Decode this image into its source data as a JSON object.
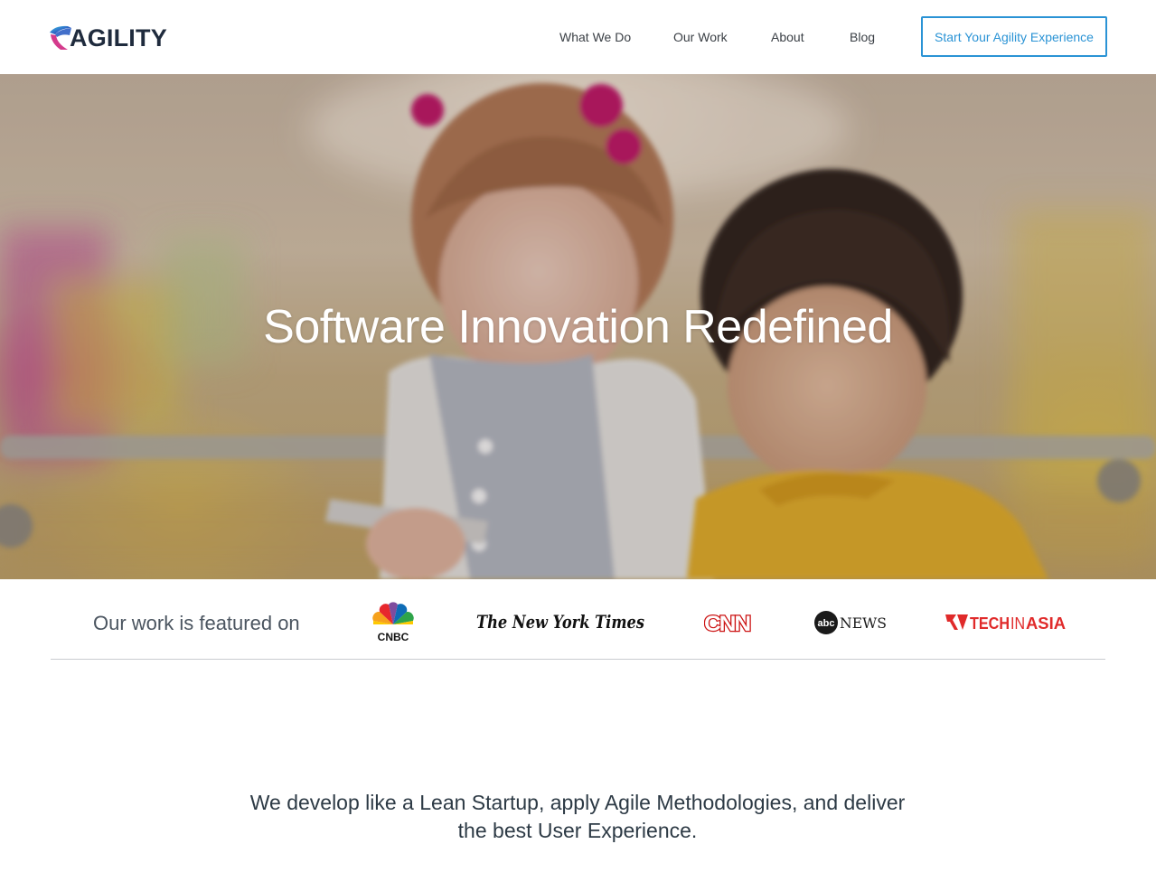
{
  "brand": {
    "name": "AGILITY",
    "colors": {
      "accent": "#2a93d5",
      "logo_dark": "#1f2b3d",
      "logo_magenta": "#d43a8c",
      "logo_blue": "#2e5fc4"
    }
  },
  "nav": {
    "items": [
      {
        "label": "What We Do"
      },
      {
        "label": "Our Work"
      },
      {
        "label": "About"
      },
      {
        "label": "Blog"
      }
    ],
    "cta_label": "Start Your Agility Experience"
  },
  "hero": {
    "title": "Software Innovation Redefined"
  },
  "featured": {
    "label": "Our work is featured on",
    "logos": [
      {
        "name": "cnbc-logo",
        "text": "CNBC"
      },
      {
        "name": "nyt-logo",
        "text": "The New York Times"
      },
      {
        "name": "cnn-logo",
        "text": "CNN"
      },
      {
        "name": "abc-news-logo",
        "text": "abc",
        "text2": "NEWS"
      },
      {
        "name": "techinasia-logo",
        "text": "TECH",
        "text2": "IN",
        "text3": "ASIA"
      }
    ]
  },
  "tagline": {
    "line1": "We develop like a Lean Startup, apply Agile Methodologies, and deliver",
    "line2": "the best User Experience."
  }
}
